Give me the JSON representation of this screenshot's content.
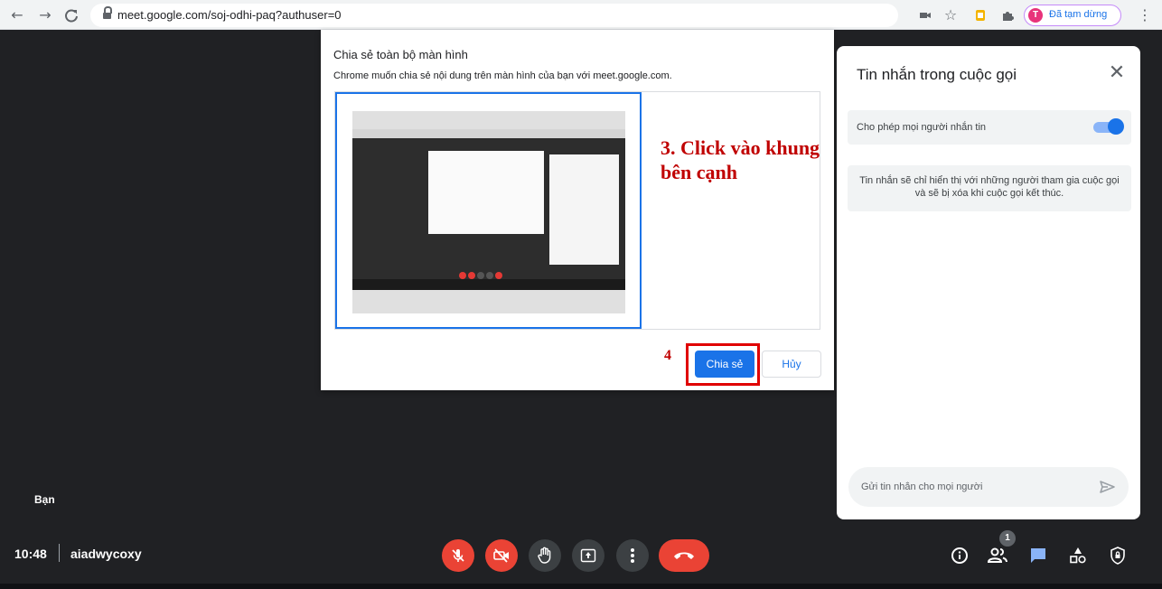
{
  "browser": {
    "url": "meet.google.com/soj-odhi-paq?authuser=0",
    "profile_initial": "T",
    "profile_status": "Đã tạm dừng",
    "icons": [
      "back-icon",
      "forward-icon",
      "reload-icon",
      "lock-icon",
      "camera-icon",
      "star-icon",
      "extension-icon",
      "puzzle-icon",
      "kebab-menu-icon"
    ]
  },
  "share_dialog": {
    "title": "Chia sẻ toàn bộ màn hình",
    "description": "Chrome muốn chia sẻ nội dung trên màn hình của bạn với meet.google.com.",
    "annotation_step3": "3. Click vào khung bên cạnh",
    "annotation_step4": "4",
    "share_label": "Chia sẻ",
    "cancel_label": "Hủy"
  },
  "chat_panel": {
    "title": "Tin nhắn trong cuộc gọi",
    "toggle_label": "Cho phép mọi người nhắn tin",
    "toggle_on": true,
    "info_text": "Tin nhắn sẽ chỉ hiển thị với những người tham gia cuộc gọi và sẽ bị xóa khi cuộc gọi kết thúc.",
    "input_placeholder": "Gửi tin nhắn cho mọi người"
  },
  "meeting": {
    "self_label": "Bạn",
    "time": "10:48",
    "separator": "|",
    "meeting_code": "aiadwycoxy",
    "participant_count": "1"
  },
  "colors": {
    "accent": "#1a73e8",
    "danger": "#ea4335",
    "annotation": "#c00000",
    "background": "#202124"
  }
}
